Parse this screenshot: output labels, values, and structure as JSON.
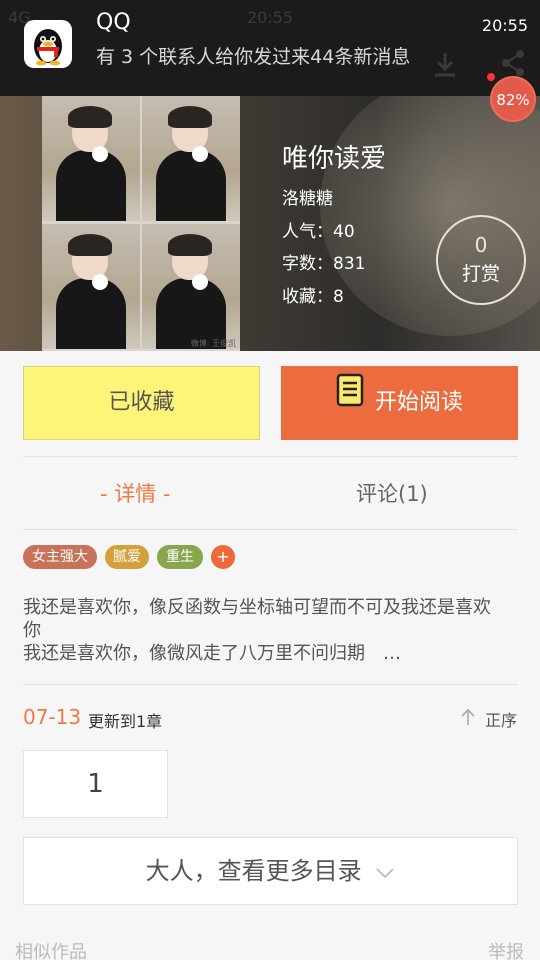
{
  "notification": {
    "app": "QQ",
    "message": "有 3 个联系人给你发过来44条新消息",
    "time": "20:55",
    "ghost_time": "20:55",
    "ghost_signal": "4G"
  },
  "battery": {
    "percent_text": "82%"
  },
  "book": {
    "title": "唯你读爱",
    "author": "洛糖糖",
    "popularity": "人气：40",
    "word_count": "字数：831",
    "favorites": "收藏：8",
    "reward_count": "0",
    "reward_label": "打赏",
    "cover_watermark": "微博: 王俊凯"
  },
  "actions": {
    "favorited_label": "已收藏",
    "start_reading_label": "开始阅读"
  },
  "tabs": {
    "detail": "- 详情 -",
    "comments": "评论(1)"
  },
  "tags": [
    "女主强大",
    "腻爱",
    "重生",
    "+"
  ],
  "description": {
    "line1": "我还是喜欢你，像反函数与坐标轴可望而不可及我还是喜欢你",
    "line2": "我还是喜欢你，像微风走了八万里不问归期　…"
  },
  "chapters": {
    "date": "07-13",
    "update_text": "更新到1章",
    "sort_label": "正序",
    "first_chapter": "1",
    "more_catalog": "大人，查看更多目录"
  },
  "footer": {
    "similar": "相似作品",
    "report": "举报"
  },
  "colors": {
    "accent_orange": "#ED6C3F",
    "fav_yellow": "#FDF577",
    "tag_1": "#C8725A",
    "tag_2": "#D3A13C",
    "tag_3": "#8AA64D"
  }
}
